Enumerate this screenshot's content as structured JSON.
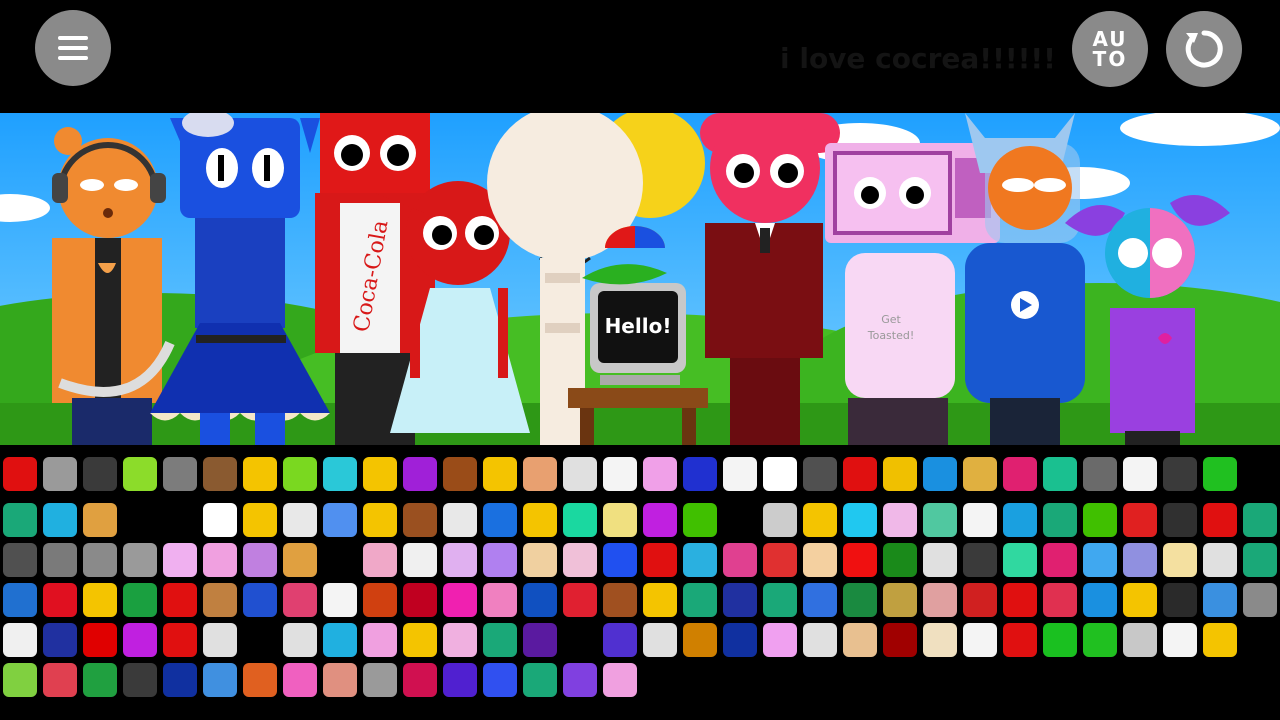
{
  "toolbar": {
    "menu_icon": "hamburger-icon",
    "auto_label_line1": "AU",
    "auto_label_line2": "TO",
    "reset_icon": "reload-icon"
  },
  "banner_text": "i love cocrea!!!!!!",
  "stage": {
    "computer_screen_text": "Hello!",
    "toaster_shirt_text_line1": "Get",
    "toaster_shirt_text_line2": "Toasted!",
    "coke_sleeve_text": "Coca-Cola"
  },
  "palette": {
    "rows": [
      [
        "#e01010",
        "#9a9a9a",
        "#3a3a3a",
        "#8cdc2a",
        "#7c7c7c",
        "#8a5a30",
        "#f4c400",
        "#7ad820",
        "#2ac8d8",
        "#f4c400",
        "#a020d8",
        "#9a4c18",
        "#f4c400",
        "#e8a070",
        "#e0e0e0",
        "#f4f4f4",
        "#f0a0e8",
        "#2030d0",
        "#f4f4f4",
        "#ffffff",
        "#505050",
        "#e01010",
        "#f0c000",
        "#1a90e0",
        "#e0b040",
        "#e02070",
        "#1ac090",
        "#6a6a6a",
        "#f4f4f4",
        "#3a3a3a",
        "#20c020"
      ],
      [
        "#1aa878",
        "#20b0e0",
        "#e0a040",
        "#000000",
        "#000000",
        "#ffffff",
        "#f4c400",
        "#e8e8e8",
        "#5090f0",
        "#f4c400",
        "#9a5020",
        "#e8e8e8",
        "#1a70e0",
        "#f4c400",
        "#1ad8a0",
        "#f0e080",
        "#c020e0",
        "#40c000",
        "#000000",
        "#cccccc",
        "#f4c400",
        "#20c8f0",
        "#f0b8e8",
        "#50c8a0",
        "#f4f4f4",
        "#1aa0e0",
        "#1aa878",
        "#40c000",
        "#e02020",
        "#303030",
        "#e01010",
        "#1aa878"
      ],
      [
        "#505050",
        "#7a7a7a",
        "#8a8a8a",
        "#9a9a9a",
        "#f0b0f0",
        "#f0a0e0",
        "#c080e0",
        "#e0a040",
        "#000000",
        "#f0a8c8",
        "#f0f0f0",
        "#e0b0f0",
        "#b080f0",
        "#f0d0a0",
        "#f0c0d8",
        "#2050f0",
        "#e01010",
        "#2ab0e0",
        "#e04090",
        "#e03030",
        "#f4d0a0",
        "#f01010",
        "#1a8a1a",
        "#e0e0e0",
        "#3a3a3a",
        "#30d8a0",
        "#e02070",
        "#40a8f0",
        "#9090e0",
        "#f4e0a0",
        "#e0e0e0",
        "#1aa878"
      ],
      [
        "#2070d0",
        "#e01020",
        "#f4c400",
        "#1aa040",
        "#e01010",
        "#c08040",
        "#2050d0",
        "#e04070",
        "#f4f4f4",
        "#d04010",
        "#c00020",
        "#f020b0",
        "#f080c0",
        "#1050c0",
        "#e02030",
        "#a05020",
        "#f4c400",
        "#1aa878",
        "#2030a0",
        "#1aa878",
        "#3070e0",
        "#1a8a40",
        "#c0a040",
        "#e0a0a0",
        "#d02020",
        "#e01010",
        "#e03050",
        "#1a90e0",
        "#f4c400",
        "#2a2a2a",
        "#3a90e0",
        "#8a8a8a"
      ],
      [
        "#f0f0f0",
        "#2030a0",
        "#e00000",
        "#c020e0",
        "#e01010",
        "#e0e0e0",
        "#000000",
        "#e0e0e0",
        "#20b0e0",
        "#f0a0e0",
        "#f4c400",
        "#f0b0e0",
        "#1aa878",
        "#5a1aa0",
        "#000000",
        "#5030d0",
        "#e0e0e0",
        "#d08000",
        "#1030a0",
        "#f0a0f0",
        "#e0e0e0",
        "#e8c090",
        "#a00000",
        "#f0e0c0",
        "#f4f4f4",
        "#e01010",
        "#1ac020",
        "#20c020",
        "#c8c8c8",
        "#f4f4f4",
        "#f4c400"
      ],
      [
        "#80d040",
        "#e04050",
        "#20a040",
        "#3a3a3a",
        "#1030a0",
        "#4090e0",
        "#e06020",
        "#f060c0",
        "#e09080",
        "#9a9a9a",
        "#d01050",
        "#5020d0",
        "#3050f0",
        "#1aa878",
        "#8040e0",
        "#f0a0e0"
      ]
    ]
  }
}
